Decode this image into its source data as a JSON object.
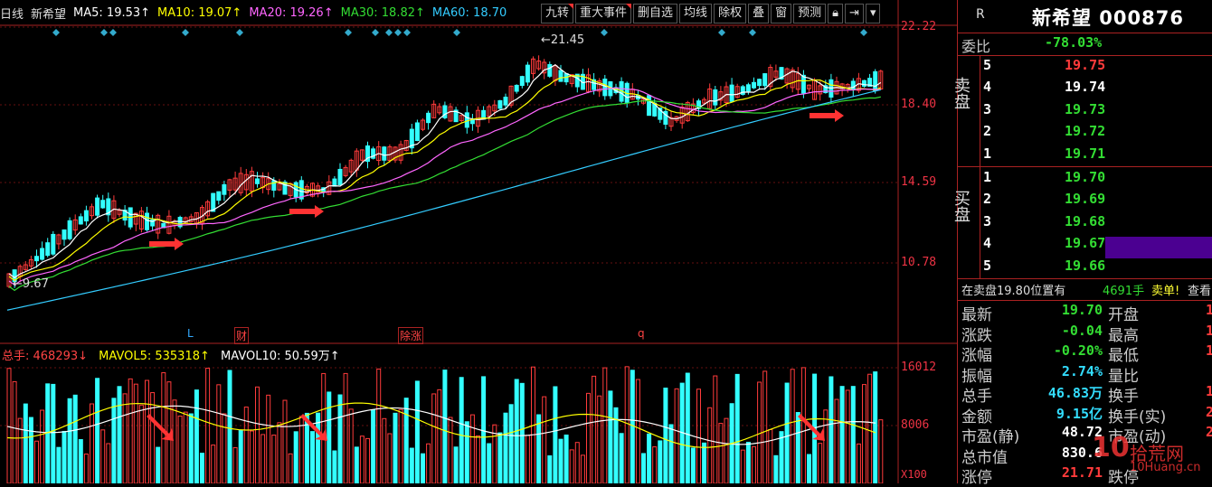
{
  "header": {
    "period": "日线",
    "name": "新希望",
    "ma": [
      {
        "label": "MA5: 19.53↑",
        "color": "#ffffff"
      },
      {
        "label": "MA10: 19.07↑",
        "color": "#ffff00"
      },
      {
        "label": "MA20: 19.26↑",
        "color": "#ff66ff"
      },
      {
        "label": "MA30: 18.82↑",
        "color": "#33dd33"
      },
      {
        "label": "MA60: 18.70",
        "color": "#33ccff"
      }
    ]
  },
  "toolbar": {
    "items": [
      "九转",
      "重大事件",
      "删自选",
      "均线",
      "除权",
      "叠",
      "窗",
      "预测"
    ],
    "lock_icon": "lock-icon",
    "arrow_icon": "arrow-right-bar-icon",
    "menu_icon": "chevron-down-icon"
  },
  "price_axis": {
    "labels": [
      "22.22",
      "18.40",
      "14.59",
      "10.78"
    ]
  },
  "annotations": {
    "high": "21.45",
    "low": "9.67"
  },
  "events": [
    {
      "text": "L",
      "color": "#33aaff"
    },
    {
      "text": "财",
      "color": "#ff4444"
    },
    {
      "text": "除涨",
      "color": "#ff4444"
    },
    {
      "text": "q",
      "color": "#ff4444"
    }
  ],
  "volume": {
    "header": [
      {
        "label": "总手: 468293↓",
        "color": "#ff4444"
      },
      {
        "label": "MAVOL5: 535318↑",
        "color": "#ffff00"
      },
      {
        "label": "MAVOL10: 50.59万↑",
        "color": "#ffffff"
      }
    ],
    "axis": [
      "16012",
      "8006",
      "X100"
    ]
  },
  "quote": {
    "code_label": "R",
    "title": "新希望 000876",
    "weibi_label": "委比",
    "weibi_value": "-78.03%",
    "sell_label": "卖盘",
    "buy_label": "买盘",
    "sell": [
      {
        "level": "5",
        "price": "19.75"
      },
      {
        "level": "4",
        "price": "19.74"
      },
      {
        "level": "3",
        "price": "19.73"
      },
      {
        "level": "2",
        "price": "19.72"
      },
      {
        "level": "1",
        "price": "19.71"
      }
    ],
    "buy": [
      {
        "level": "1",
        "price": "19.70"
      },
      {
        "level": "2",
        "price": "19.69"
      },
      {
        "level": "3",
        "price": "19.68"
      },
      {
        "level": "4",
        "price": "19.67"
      },
      {
        "level": "5",
        "price": "19.66"
      }
    ],
    "notice": {
      "prefix": "在卖盘19.80位置有",
      "qty": "4691手",
      "suffix": "卖单!",
      "link": "查看"
    },
    "stats": [
      {
        "l": "最新",
        "v": "19.70",
        "vc": "grn",
        "r": "开盘",
        "rv": "1"
      },
      {
        "l": "涨跌",
        "v": "-0.04",
        "vc": "grn",
        "r": "最高",
        "rv": "1"
      },
      {
        "l": "涨幅",
        "v": "-0.20%",
        "vc": "grn",
        "r": "最低",
        "rv": "1"
      },
      {
        "l": "振幅",
        "v": "2.74%",
        "vc": "cyn",
        "r": "量比",
        "rv": ""
      },
      {
        "l": "总手",
        "v": "46.83万",
        "vc": "cyn",
        "r": "换手",
        "rv": "1"
      },
      {
        "l": "金额",
        "v": "9.15亿",
        "vc": "cyn",
        "r": "换手(实)",
        "rv": "2"
      },
      {
        "l": "市盈(静)",
        "v": "48.72",
        "vc": "wht",
        "r": "市盈(动)",
        "rv": "2"
      },
      {
        "l": "总市值",
        "v": "830.6",
        "vc": "wht",
        "r": "",
        "rv": ""
      },
      {
        "l": "涨停",
        "v": "21.71",
        "vc": "red",
        "r": "跌停",
        "rv": ""
      }
    ]
  },
  "watermark": {
    "text": "拾荒网",
    "sub": "10Huang.cn"
  }
}
